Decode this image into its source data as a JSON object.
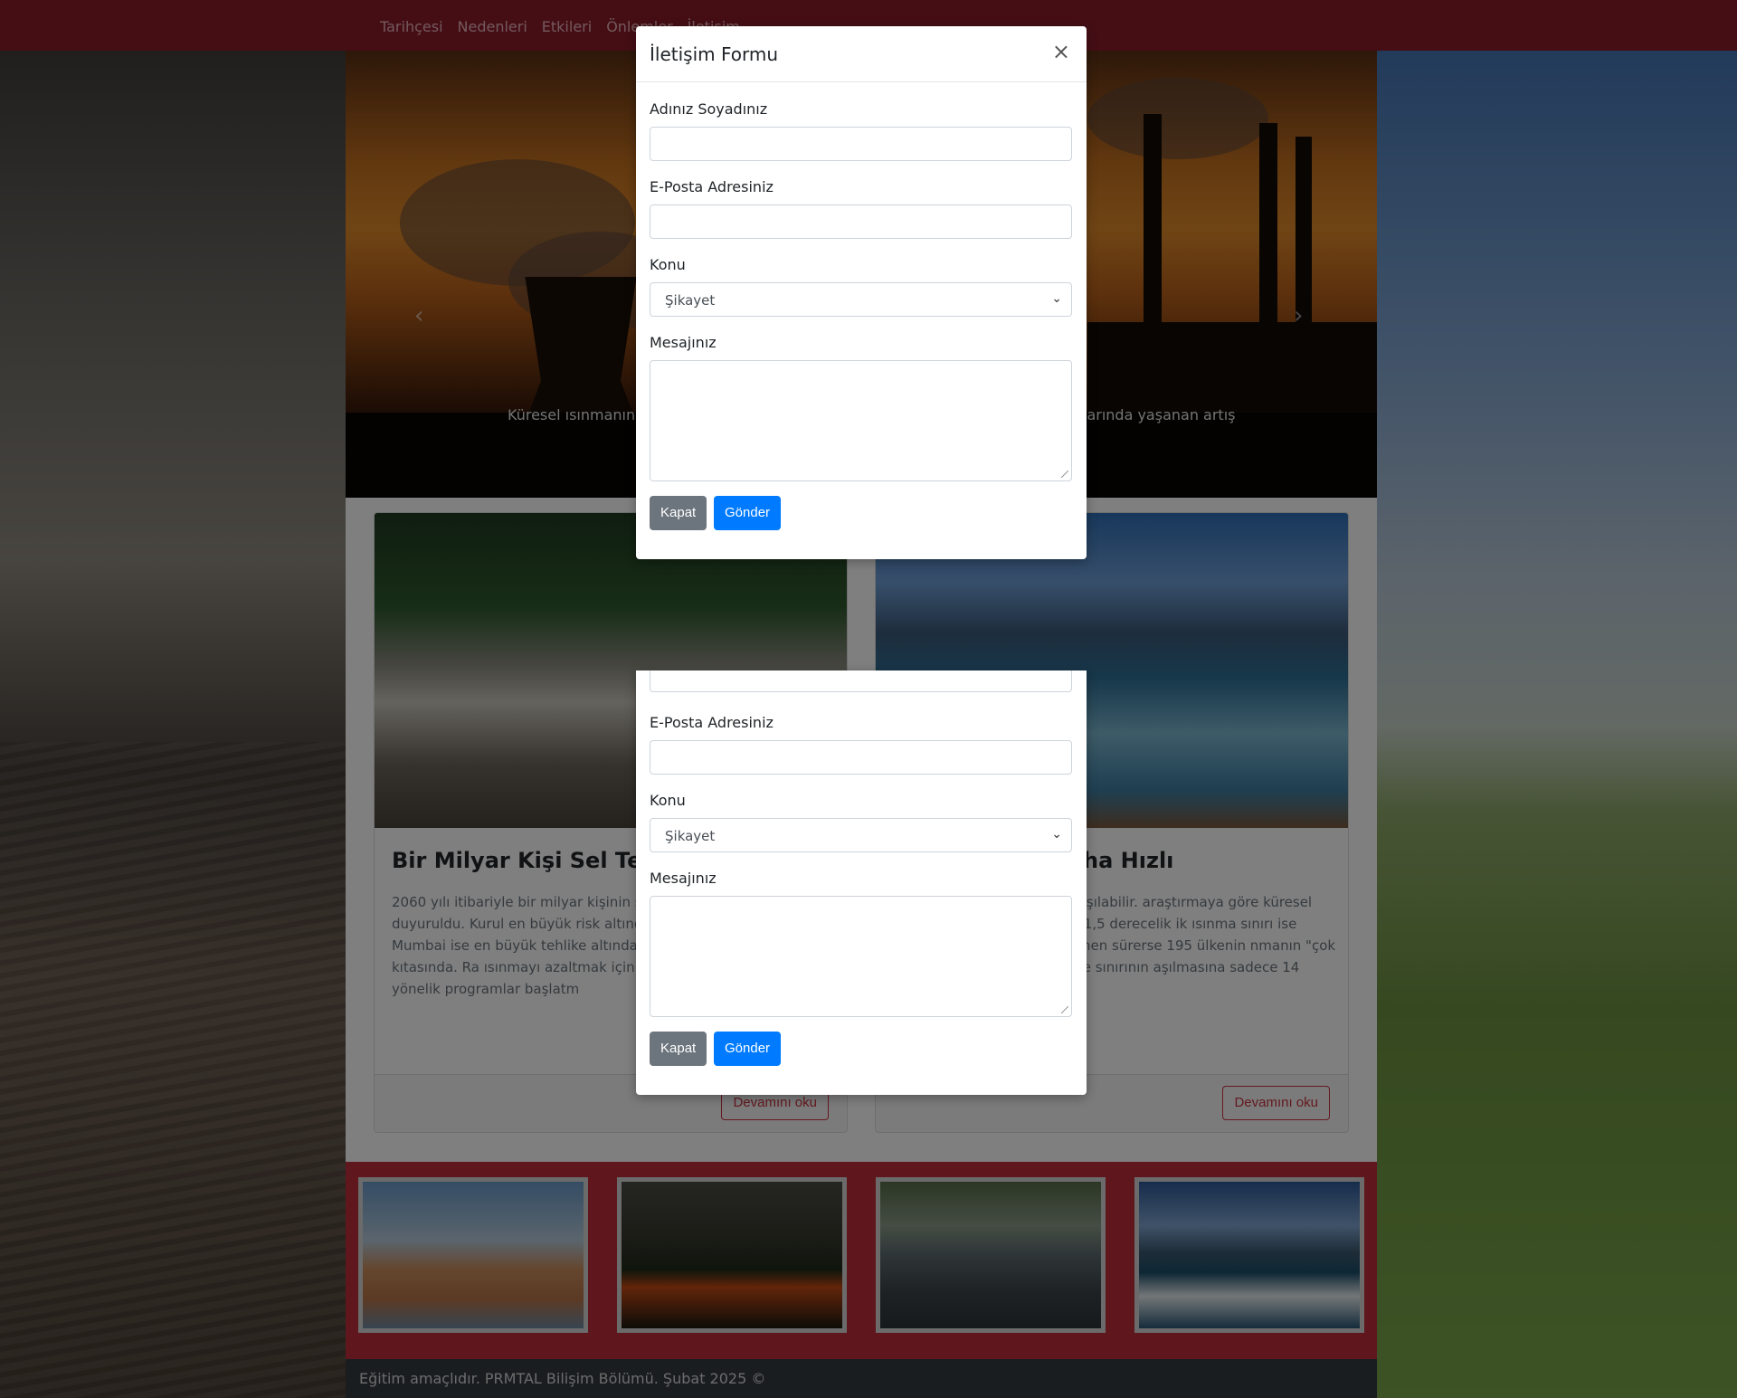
{
  "nav": {
    "links": [
      "Tarihçesi",
      "Nedenleri",
      "Etkileri",
      "Önlemler",
      "İletişim"
    ]
  },
  "carousel": {
    "caption_left": "Küresel ısınmanın en",
    "caption_right": "larında yaşanan artış",
    "prev_icon": "‹",
    "next_icon": "›"
  },
  "cards": [
    {
      "title": "Bir Milyar Kişi Sel Tehdidi",
      "text": "2060 yılı itibariyle bir milyar kişinin sel şehirlerde yaşayacağı duyuruldu. Kurul en büyük risk altındakiler ABD, Çin ve ile Mumbai ise en büyük tehlike altında altındaki sekiz şehir Asya kıtasında. Ra ısınmayı azaltmak için hareket geçme azaltmaya yönelik programlar başlatm",
      "button": "Devamını oku"
    },
    {
      "title": "ndığımızdan Daha Hızlı",
      "text": "beklediğimizden daha hızlı aşılabilir. araştırmaya göre küresel enerji maya devam ederse, 1,5 derecelik ik ısınma sınırı ise 2030'da aşılabilir. sistem aynen sürerse 195 ülkenin nmanın \"çok altında\" durdurulması derece sınırının aşılmasına sadece 14",
      "button": "Devamını oku"
    }
  ],
  "footer": {
    "text": "Eğitim amaçlıdır. PRMTAL Bilişim Bölümü. Şubat 2025 ©"
  },
  "modal": {
    "title": "İletişim Formu",
    "close": "×",
    "name_label": "Adınız Soyadınız",
    "email_label": "E-Posta Adresiniz",
    "subject_label": "Konu",
    "subject_value": "Şikayet",
    "message_label": "Mesajınız",
    "close_button": "Kapat",
    "submit_button": "Gönder"
  },
  "colors": {
    "navbar": "#8b1c2b",
    "gallery": "#c12c3b",
    "footer": "#343a40",
    "primary": "#007bff",
    "secondary": "#6c757d",
    "outline": "#c8323f"
  }
}
